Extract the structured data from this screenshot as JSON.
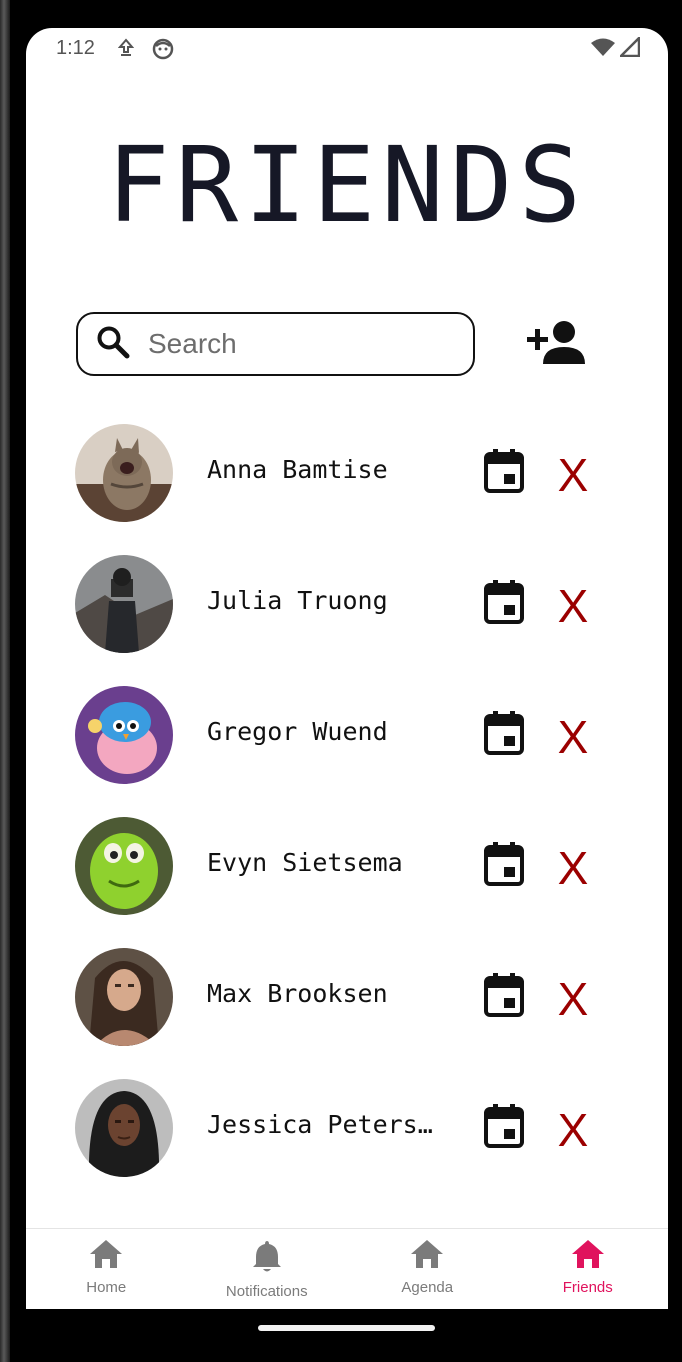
{
  "status_bar": {
    "time": "1:12",
    "icons": [
      "download-icon",
      "face-icon",
      "wifi-icon",
      "signal-icon"
    ]
  },
  "header": {
    "title": "FRIENDS"
  },
  "search": {
    "placeholder": "Search",
    "value": "",
    "icon": "search-icon"
  },
  "actions": {
    "add_friend_icon": "add-person-icon"
  },
  "friends": [
    {
      "name": "Anna Bamtise",
      "avatar": "tabby-cat-photo"
    },
    {
      "name": "Julia Truong",
      "avatar": "photographer-photo"
    },
    {
      "name": "Gregor Wuend",
      "avatar": "fluffy-bird-illustration"
    },
    {
      "name": "Evyn Sietsema",
      "avatar": "green-monster-photo"
    },
    {
      "name": "Max Brooksen",
      "avatar": "woman-portrait-photo"
    },
    {
      "name": "Jessica Peters…",
      "avatar": "woman-headscarf-photo"
    }
  ],
  "row_actions": {
    "calendar_icon": "calendar-icon",
    "remove_label": "X"
  },
  "bottom_nav": [
    {
      "label": "Home",
      "icon": "home-icon",
      "active": false
    },
    {
      "label": "Notifications",
      "icon": "bell-icon",
      "active": false
    },
    {
      "label": "Agenda",
      "icon": "home-icon",
      "active": false
    },
    {
      "label": "Friends",
      "icon": "home-icon",
      "active": true
    }
  ],
  "colors": {
    "title": "#161826",
    "remove": "#9b0000",
    "nav_active": "#e0135d",
    "nav_inactive": "#7b7b7b"
  }
}
